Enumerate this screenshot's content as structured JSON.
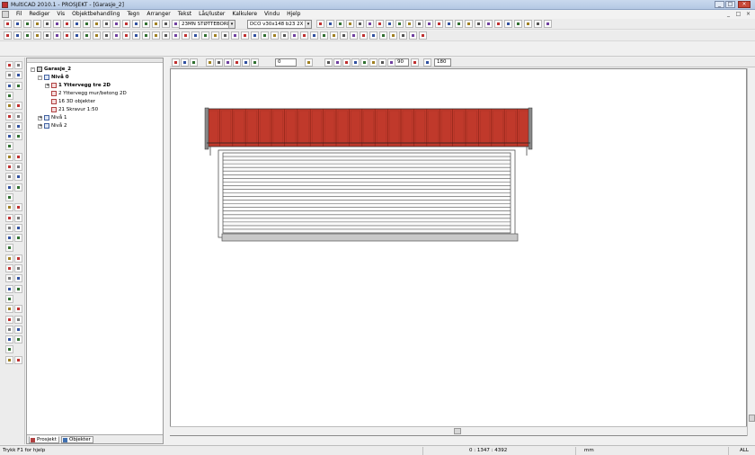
{
  "window": {
    "title": "MultiCAD 2010.1 - PROSJEKT - [Garasje_2]",
    "controls": [
      "_",
      "□",
      "×"
    ]
  },
  "menu": {
    "items": [
      "Fil",
      "Rediger",
      "Vis",
      "Objektbehandling",
      "Tegn",
      "Arranger",
      "Tekst",
      "Lås/luster",
      "Kalkulere",
      "Vindu",
      "Hjelp"
    ],
    "mdi_controls": [
      "_",
      "□",
      "×"
    ]
  },
  "toolbar": {
    "layer_combo": "23MN STØTTEBORD",
    "material_combo": "DCO v30x148 b23 2X"
  },
  "draw_toolbar": {
    "offset_value": "0",
    "angle_value": "90",
    "rotation_value": "180"
  },
  "tree": {
    "root": "Garasje_2",
    "nodes": [
      {
        "label": "Nivå 0",
        "level": 1,
        "bold": true,
        "expander": "-"
      },
      {
        "label": "1 Yttervegg tre 2D",
        "level": 2,
        "bold": true,
        "expander": "+"
      },
      {
        "label": "2 Yttervegg mur/betong 2D",
        "level": 2,
        "bold": false,
        "expander": ""
      },
      {
        "label": "16 3D objekter",
        "level": 2,
        "bold": false,
        "expander": ""
      },
      {
        "label": "21 Skravur 1:50",
        "level": 2,
        "bold": false,
        "expander": ""
      },
      {
        "label": "Nivå 1",
        "level": 1,
        "bold": false,
        "expander": "+"
      },
      {
        "label": "Nivå 2",
        "level": 1,
        "bold": false,
        "expander": "+"
      }
    ],
    "tabs": [
      "Prosjekt",
      "Objekter"
    ]
  },
  "drawing": {
    "roof_color": "#c0392b",
    "roof_dark": "#8e2418",
    "roof_tiles": 25,
    "door_slats": 22,
    "foundation_color": "#c8c8c8"
  },
  "status": {
    "help": "Trykk F1 for hjelp",
    "coords": "0 : 1347 : 4392",
    "unit": "mm",
    "mode": "ALL"
  }
}
